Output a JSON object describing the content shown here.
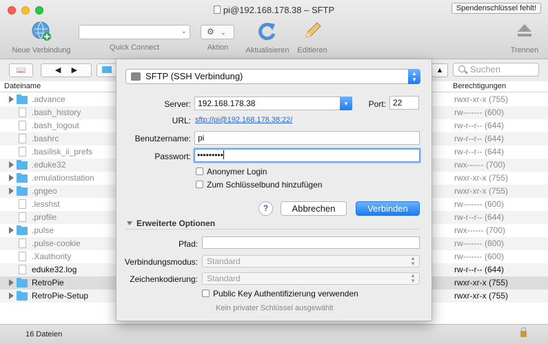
{
  "window": {
    "title": "pi@192.168.178.38 – SFTP",
    "donate_label": "Spendenschlüssel fehlt!"
  },
  "toolbar": {
    "new_connection": "Neue Verbindung",
    "quick_connect": "Quick Connect",
    "action": "Aktion",
    "refresh": "Aktualisieren",
    "edit": "Editieren",
    "disconnect": "Trennen"
  },
  "search": {
    "placeholder": "Suchen"
  },
  "columns": {
    "name": "Dateiname",
    "permissions": "Berechtigungen"
  },
  "files": [
    {
      "name": ".advance",
      "type": "folder",
      "perm": "rwxr-xr-x (755)"
    },
    {
      "name": ".bash_history",
      "type": "file",
      "perm": "rw------- (600)"
    },
    {
      "name": ".bash_logout",
      "type": "file",
      "perm": "rw-r--r-- (644)"
    },
    {
      "name": ".bashrc",
      "type": "file",
      "perm": "rw-r--r-- (644)"
    },
    {
      "name": ".basilisk_ii_prefs",
      "type": "file",
      "perm": "rw-r--r-- (644)"
    },
    {
      "name": ".eduke32",
      "type": "folder",
      "perm": "rwx------ (700)"
    },
    {
      "name": ".emulationstation",
      "type": "folder",
      "perm": "rwxr-xr-x (755)"
    },
    {
      "name": ".gngeo",
      "type": "folder",
      "perm": "rwxr-xr-x (755)"
    },
    {
      "name": ".lesshst",
      "type": "file",
      "perm": "rw------- (600)"
    },
    {
      "name": ".profile",
      "type": "file",
      "perm": "rw-r--r-- (644)"
    },
    {
      "name": ".pulse",
      "type": "folder",
      "perm": "rwx------ (700)"
    },
    {
      "name": ".pulse-cookie",
      "type": "file",
      "perm": "rw------- (600)"
    },
    {
      "name": ".Xauthority",
      "type": "file",
      "perm": "rw------- (600)"
    },
    {
      "name": "eduke32.log",
      "type": "file",
      "perm": "rw-r--r-- (644)"
    },
    {
      "name": "RetroPie",
      "type": "folder",
      "perm": "rwxr-xr-x (755)"
    },
    {
      "name": "RetroPie-Setup",
      "type": "folder",
      "perm": "rwxr-xr-x (755)"
    }
  ],
  "status": {
    "count": "16 Dateien"
  },
  "dialog": {
    "protocol": "SFTP (SSH Verbindung)",
    "server_label": "Server:",
    "server_value": "192.168.178.38",
    "port_label": "Port:",
    "port_value": "22",
    "url_label": "URL:",
    "url_value": "sftp://pi@192.168.178.38:22/",
    "username_label": "Benutzername:",
    "username_value": "pi",
    "password_label": "Passwort:",
    "password_value": "•••••••••",
    "anonymous_label": "Anonymer Login",
    "keychain_label": "Zum Schlüsselbund hinzufügen",
    "help_label": "?",
    "cancel_label": "Abbrechen",
    "connect_label": "Verbinden",
    "advanced_label": "Erweiterte Optionen",
    "path_label": "Pfad:",
    "path_value": "",
    "mode_label": "Verbindungsmodus:",
    "mode_value": "Standard",
    "encoding_label": "Zeichenkodierung:",
    "encoding_value": "Standard",
    "pubkey_label": "Public Key Authentifizierung verwenden",
    "nokey_label": "Kein privater Schlüssel ausgewählt"
  },
  "colors": {
    "accent": "#1b7cf2",
    "folder": "#58b4ec"
  }
}
